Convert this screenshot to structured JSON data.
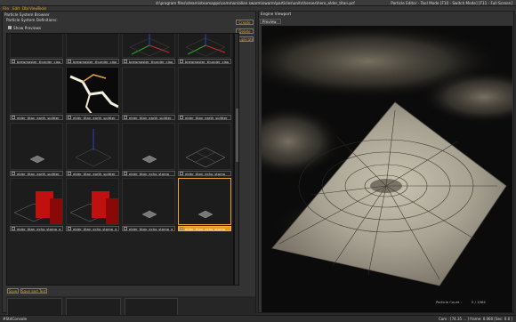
{
  "window": {
    "path": "d:\\program files\\steam\\steamapps\\common\\alien swarm\\swarm\\particles\\units\\heroes\\hero_elder_titan.pcf",
    "mode": "Particle Editor - Tool Mode [F10 - Switch Mode] [F11 - Full Screen]"
  },
  "menu": [
    "File",
    "Edit",
    "Dbl",
    "View",
    "Tools"
  ],
  "browser": {
    "title": "Particle System Browser",
    "group_label": "Particle System Definitions:",
    "create_label": "Create",
    "delete_label": "Delete",
    "duplicate_label": "Duplicate",
    "show_previews_label": "Show Previews",
    "tiles": [
      {
        "label": "brewmaster_thunder_clap",
        "thumb": "dark"
      },
      {
        "label": "brewmaster_thunder_clap",
        "thumb": "dark"
      },
      {
        "label": "brewmaster_thunder_clap",
        "thumb": "axes"
      },
      {
        "label": "brewmaster_thunder_clap",
        "thumb": "axes"
      },
      {
        "label": "elder_titan_earth_splitter",
        "thumb": "dark"
      },
      {
        "label": "elder_titan_earth_splitter",
        "thumb": "crack"
      },
      {
        "label": "elder_titan_earth_splitter",
        "thumb": "dark"
      },
      {
        "label": "elder_titan_earth_splitter",
        "thumb": "dark"
      },
      {
        "label": "elder_titan_earth_splitter",
        "thumb": "smallgrid"
      },
      {
        "label": "elder_titan_earth_splitter",
        "thumb": "axes-grid"
      },
      {
        "label": "elder_titan_echo_stomp",
        "thumb": "smallgrid"
      },
      {
        "label": "elder_titan_echo_stomp",
        "thumb": "grid"
      },
      {
        "label": "elder_titan_echo_stomp_a",
        "thumb": "red"
      },
      {
        "label": "elder_titan_echo_stomp_a",
        "thumb": "red"
      },
      {
        "label": "elder_titan_echo_stomp_a",
        "thumb": "smallgrid"
      },
      {
        "label": "elder_titan_echo_stomp",
        "thumb": "smallgrid"
      }
    ],
    "selected_index": 15,
    "save_label": "Save",
    "save_and_test_label": "Save and Test"
  },
  "viewport": {
    "title": "Engine Viewport",
    "tab_label": "Preview",
    "particle_count_label": "Particle Count :",
    "particle_count_value": "0 / 1964"
  },
  "status": {
    "left": "#StdConsole",
    "right": "Cam : [74.35 ... ] frame: 0.060  [Sec: 0.0 ]"
  },
  "colors": {
    "accent": "#e89a18",
    "menu_text": "#e0a020"
  }
}
